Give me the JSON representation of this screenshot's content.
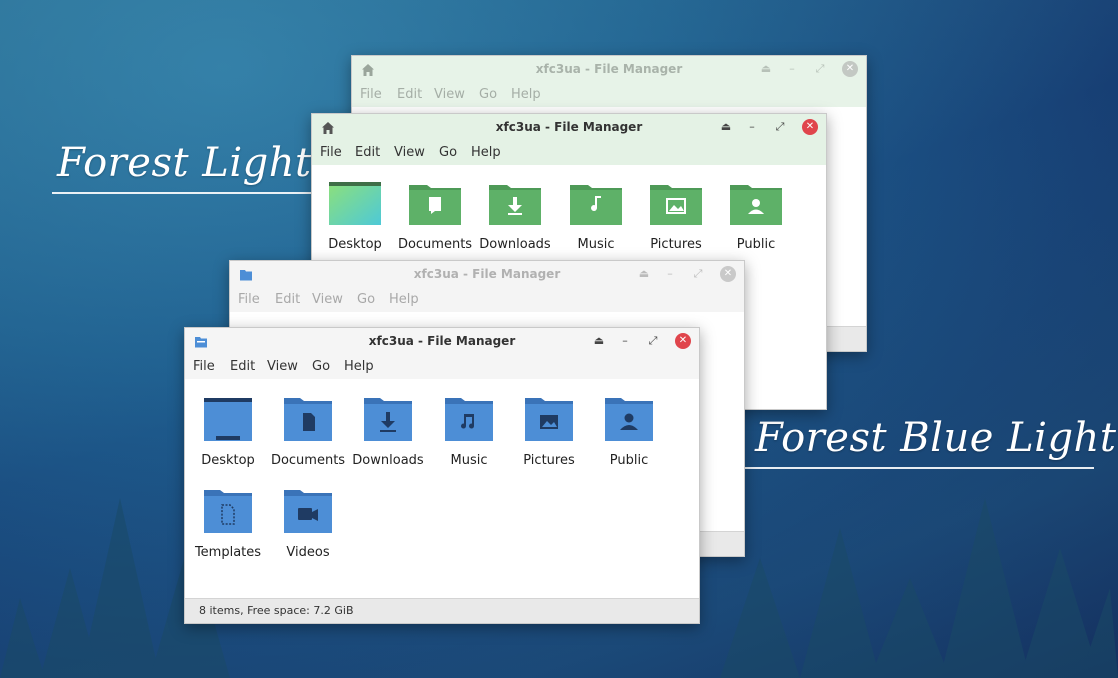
{
  "labels": {
    "forest_light": "Forest Light",
    "forest_blue_light": "Forest Blue Light"
  },
  "colors": {
    "green_folder": "#5eb168",
    "green_folder_tab": "#4e9a57",
    "blue_folder": "#4d8ed6",
    "blue_folder_tab": "#3a73b8",
    "close_red": "#e0454c",
    "close_inactive": "#c3c3c3"
  },
  "windows": {
    "forest_light_back": {
      "title": "xfc3ua - File Manager",
      "menu": [
        "File",
        "Edit",
        "View",
        "Go",
        "Help"
      ]
    },
    "forest_light_front": {
      "title": "xfc3ua - File Manager",
      "menu": [
        "File",
        "Edit",
        "View",
        "Go",
        "Help"
      ],
      "items": [
        {
          "label": "Desktop",
          "icon": "desktop-icon"
        },
        {
          "label": "Documents",
          "icon": "documents-folder-icon"
        },
        {
          "label": "Downloads",
          "icon": "downloads-folder-icon"
        },
        {
          "label": "Music",
          "icon": "music-folder-icon"
        },
        {
          "label": "Pictures",
          "icon": "pictures-folder-icon"
        },
        {
          "label": "Public",
          "icon": "public-folder-icon"
        }
      ]
    },
    "forest_blue_back": {
      "title": "xfc3ua - File Manager",
      "menu": [
        "File",
        "Edit",
        "View",
        "Go",
        "Help"
      ]
    },
    "forest_blue_front": {
      "title": "xfc3ua - File Manager",
      "menu": [
        "File",
        "Edit",
        "View",
        "Go",
        "Help"
      ],
      "items": [
        {
          "label": "Desktop",
          "icon": "desktop-icon"
        },
        {
          "label": "Documents",
          "icon": "documents-folder-icon"
        },
        {
          "label": "Downloads",
          "icon": "downloads-folder-icon"
        },
        {
          "label": "Music",
          "icon": "music-folder-icon"
        },
        {
          "label": "Pictures",
          "icon": "pictures-folder-icon"
        },
        {
          "label": "Public",
          "icon": "public-folder-icon"
        },
        {
          "label": "Templates",
          "icon": "templates-folder-icon"
        },
        {
          "label": "Videos",
          "icon": "videos-folder-icon"
        }
      ],
      "status": "8 items, Free space: 7.2 GiB"
    }
  }
}
